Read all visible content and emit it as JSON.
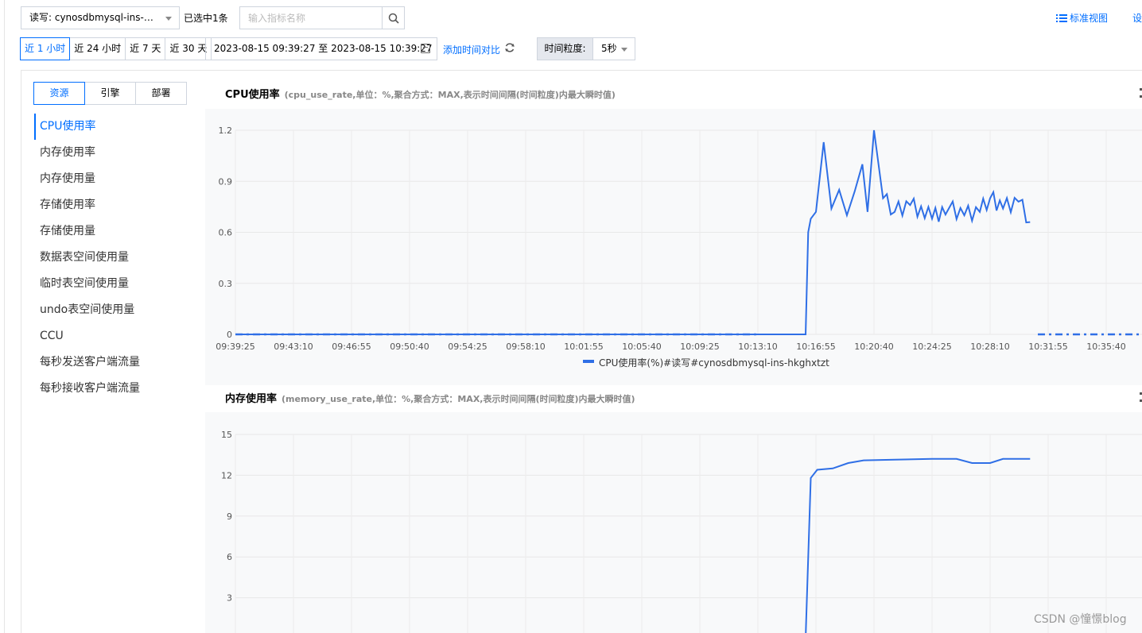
{
  "toolbar": {
    "instance_select": "读写: cynosdbmysql-ins-hkg...",
    "selected_count": "已选中1条",
    "search_placeholder": "输入指标名称",
    "standard_view": "标准视图",
    "settings": "设"
  },
  "time": {
    "buttons": [
      "近 1 小时",
      "近 24 小时",
      "近 7 天",
      "近 30 天"
    ],
    "active_index": 0,
    "range": "2023-08-15 09:39:27 至 2023-08-15 10:39:27",
    "compare": "添加时间对比",
    "granularity_label": "时间粒度:",
    "granularity_value": "5秒"
  },
  "categories": {
    "tabs": [
      "资源",
      "引擎",
      "部署"
    ],
    "active_index": 0
  },
  "metrics": {
    "items": [
      "CPU使用率",
      "内存使用率",
      "内存使用量",
      "存储使用率",
      "存储使用量",
      "数据表空间使用量",
      "临时表空间使用量",
      "undo表空间使用量",
      "CCU",
      "每秒发送客户端流量",
      "每秒接收客户端流量"
    ],
    "active_index": 0
  },
  "charts": {
    "cpu": {
      "title": "CPU使用率",
      "subtitle": "(cpu_use_rate,单位：%,聚合方式：MAX,表示时间间隔(时间粒度)内最大瞬时值)"
    },
    "mem": {
      "title": "内存使用率",
      "subtitle": "(memory_use_rate,单位：%,聚合方式：MAX,表示时间间隔(时间粒度)内最大瞬时值)"
    }
  },
  "colors": {
    "accent": "#006eff",
    "series": "#2f6fe6"
  },
  "watermark": "CSDN @憧憬blog",
  "chart_data": [
    {
      "type": "line",
      "x_ticks": [
        "09:39:25",
        "09:43:10",
        "09:46:55",
        "09:50:40",
        "09:54:25",
        "09:58:10",
        "10:01:55",
        "10:05:40",
        "10:09:25",
        "10:13:10",
        "10:16:55",
        "10:20:40",
        "10:24:25",
        "10:28:10",
        "10:31:55",
        "10:35:40"
      ],
      "y_ticks": [
        "0",
        "0.3",
        "0.6",
        "0.9",
        "1.2"
      ],
      "ylim": [
        0,
        1.2
      ],
      "series": [
        {
          "name": "CPU使用率(%)#读写#cynosdbmysql-ins-hkghxtzt",
          "x": [
            "09:39:25",
            "10:13:10",
            "10:16:15",
            "10:16:25",
            "10:16:35",
            "10:16:55",
            "10:17:25",
            "10:17:55",
            "10:18:25",
            "10:18:55",
            "10:19:25",
            "10:19:55",
            "10:20:15",
            "10:20:40",
            "10:21:15",
            "10:22:00",
            "10:23:00",
            "10:24:25",
            "10:25:30",
            "10:26:30",
            "10:27:30",
            "10:28:10",
            "10:29:00",
            "10:30:00",
            "10:30:45"
          ],
          "values": [
            0,
            0,
            0,
            0.6,
            0.68,
            0.72,
            1.13,
            0.74,
            0.85,
            0.7,
            0.84,
            1.0,
            0.72,
            1.2,
            0.8,
            0.72,
            0.76,
            0.68,
            0.74,
            0.7,
            0.72,
            0.8,
            0.74,
            0.78,
            0.66
          ],
          "gap_after": "10:30:45",
          "resume_x": "10:31:15"
        }
      ],
      "legend": "bottom-center",
      "grid": true
    },
    {
      "type": "line",
      "y_ticks": [
        "3",
        "6",
        "9",
        "12",
        "15"
      ],
      "ylim": [
        0,
        15
      ],
      "series": [
        {
          "x": [
            "10:16:15",
            "10:16:35",
            "10:17:00",
            "10:18:00",
            "10:19:00",
            "10:20:00",
            "10:22:00",
            "10:24:25",
            "10:26:00",
            "10:27:00",
            "10:28:10",
            "10:29:00",
            "10:30:45"
          ],
          "values": [
            0,
            11.8,
            12.4,
            12.5,
            12.9,
            13.1,
            13.15,
            13.2,
            13.2,
            12.9,
            12.9,
            13.2,
            13.2
          ]
        }
      ],
      "grid": true
    }
  ]
}
